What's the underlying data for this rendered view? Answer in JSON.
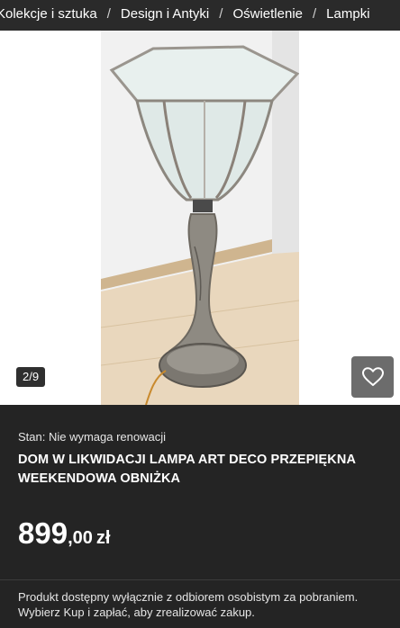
{
  "breadcrumb": {
    "items": [
      "Kolekcje i sztuka",
      "Design i Antyki",
      "Oświetlenie",
      "Lampki"
    ],
    "separator": "/"
  },
  "gallery": {
    "counter": "2/9",
    "favorite_icon": "heart-icon"
  },
  "listing": {
    "condition": "Stan: Nie wymaga renowacji",
    "title": "DOM W LIKWIDACJI LAMPA ART DECO PRZEPIĘKNA WEEKENDOWA OBNIŻKA",
    "price_main": "899",
    "price_fraction": ",00",
    "price_currency": "zł",
    "notice": "Produkt dostępny wyłącznie z odbiorem osobistym za pobraniem. Wybierz Kup i zapłać, aby zrealizować zakup."
  },
  "colors": {
    "background": "#222222",
    "breadcrumb_bar": "#2a2a2a",
    "favorite_button": "#6c6c6c"
  }
}
